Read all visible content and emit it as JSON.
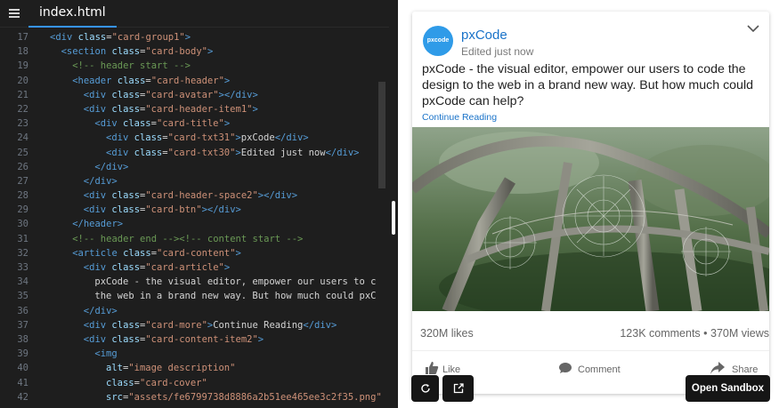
{
  "editor": {
    "tab": "index.html",
    "lines": [
      {
        "n": "17",
        "indent": 2,
        "kind": "open",
        "tag": "div",
        "attr": "class",
        "val": "card-group1"
      },
      {
        "n": "18",
        "indent": 3,
        "kind": "open",
        "tag": "section",
        "attr": "class",
        "val": "card-body"
      },
      {
        "n": "19",
        "indent": 4,
        "kind": "comment",
        "text": "<!-- header start -->"
      },
      {
        "n": "20",
        "indent": 4,
        "kind": "open",
        "tag": "header",
        "attr": "class",
        "val": "card-header"
      },
      {
        "n": "21",
        "indent": 5,
        "kind": "elem",
        "tag": "div",
        "attr": "class",
        "val": "card-avatar",
        "inner": ""
      },
      {
        "n": "22",
        "indent": 5,
        "kind": "open",
        "tag": "div",
        "attr": "class",
        "val": "card-header-item1"
      },
      {
        "n": "23",
        "indent": 6,
        "kind": "open",
        "tag": "div",
        "attr": "class",
        "val": "card-title"
      },
      {
        "n": "24",
        "indent": 7,
        "kind": "elem",
        "tag": "div",
        "attr": "class",
        "val": "card-txt31",
        "inner": "pxCode"
      },
      {
        "n": "25",
        "indent": 7,
        "kind": "elem",
        "tag": "div",
        "attr": "class",
        "val": "card-txt30",
        "inner": "Edited just now"
      },
      {
        "n": "26",
        "indent": 6,
        "kind": "close",
        "tag": "div"
      },
      {
        "n": "27",
        "indent": 5,
        "kind": "close",
        "tag": "div"
      },
      {
        "n": "28",
        "indent": 5,
        "kind": "elem",
        "tag": "div",
        "attr": "class",
        "val": "card-header-space2",
        "inner": ""
      },
      {
        "n": "29",
        "indent": 5,
        "kind": "elem",
        "tag": "div",
        "attr": "class",
        "val": "card-btn",
        "inner": ""
      },
      {
        "n": "30",
        "indent": 4,
        "kind": "close",
        "tag": "header"
      },
      {
        "n": "31",
        "indent": 4,
        "kind": "comment",
        "text": "<!-- header end --><!-- content start -->"
      },
      {
        "n": "32",
        "indent": 4,
        "kind": "open",
        "tag": "article",
        "attr": "class",
        "val": "card-content"
      },
      {
        "n": "33",
        "indent": 5,
        "kind": "open",
        "tag": "div",
        "attr": "class",
        "val": "card-article"
      },
      {
        "n": "34",
        "indent": 6,
        "kind": "text",
        "text": "pxCode - the visual editor, empower our users to c"
      },
      {
        "n": "35",
        "indent": 6,
        "kind": "text",
        "text": "the web in a brand new way. But how much could pxC"
      },
      {
        "n": "36",
        "indent": 5,
        "kind": "close",
        "tag": "div"
      },
      {
        "n": "37",
        "indent": 5,
        "kind": "elem",
        "tag": "div",
        "attr": "class",
        "val": "card-more",
        "inner": "Continue Reading"
      },
      {
        "n": "38",
        "indent": 5,
        "kind": "open",
        "tag": "div",
        "attr": "class",
        "val": "card-content-item2"
      },
      {
        "n": "39",
        "indent": 6,
        "kind": "raw",
        "tag": "img"
      },
      {
        "n": "40",
        "indent": 7,
        "kind": "attrline",
        "attr": "alt",
        "val": "image description"
      },
      {
        "n": "41",
        "indent": 7,
        "kind": "attrline",
        "attr": "class",
        "val": "card-cover"
      },
      {
        "n": "42",
        "indent": 7,
        "kind": "attrline",
        "attr": "src",
        "val": "assets/fe6799738d8886a2b51ee465ee3c2f35.png"
      }
    ]
  },
  "preview": {
    "avatar_text": "pxcode",
    "title": "pxCode",
    "subtitle": "Edited just now",
    "article": "pxCode - the visual editor, empower our users to code the design to the web in a brand new way. But how much could pxCode can help?",
    "more": "Continue Reading",
    "likes": "320M likes",
    "comments": "123K comments • 370M views",
    "actions": {
      "like": "Like",
      "comment": "Comment",
      "share": "Share"
    }
  },
  "controls": {
    "open_sandbox": "Open Sandbox"
  },
  "colors": {
    "accent": "#1a73c9",
    "editor_bg": "#1e1e1e",
    "avatar": "#2f9be8"
  }
}
